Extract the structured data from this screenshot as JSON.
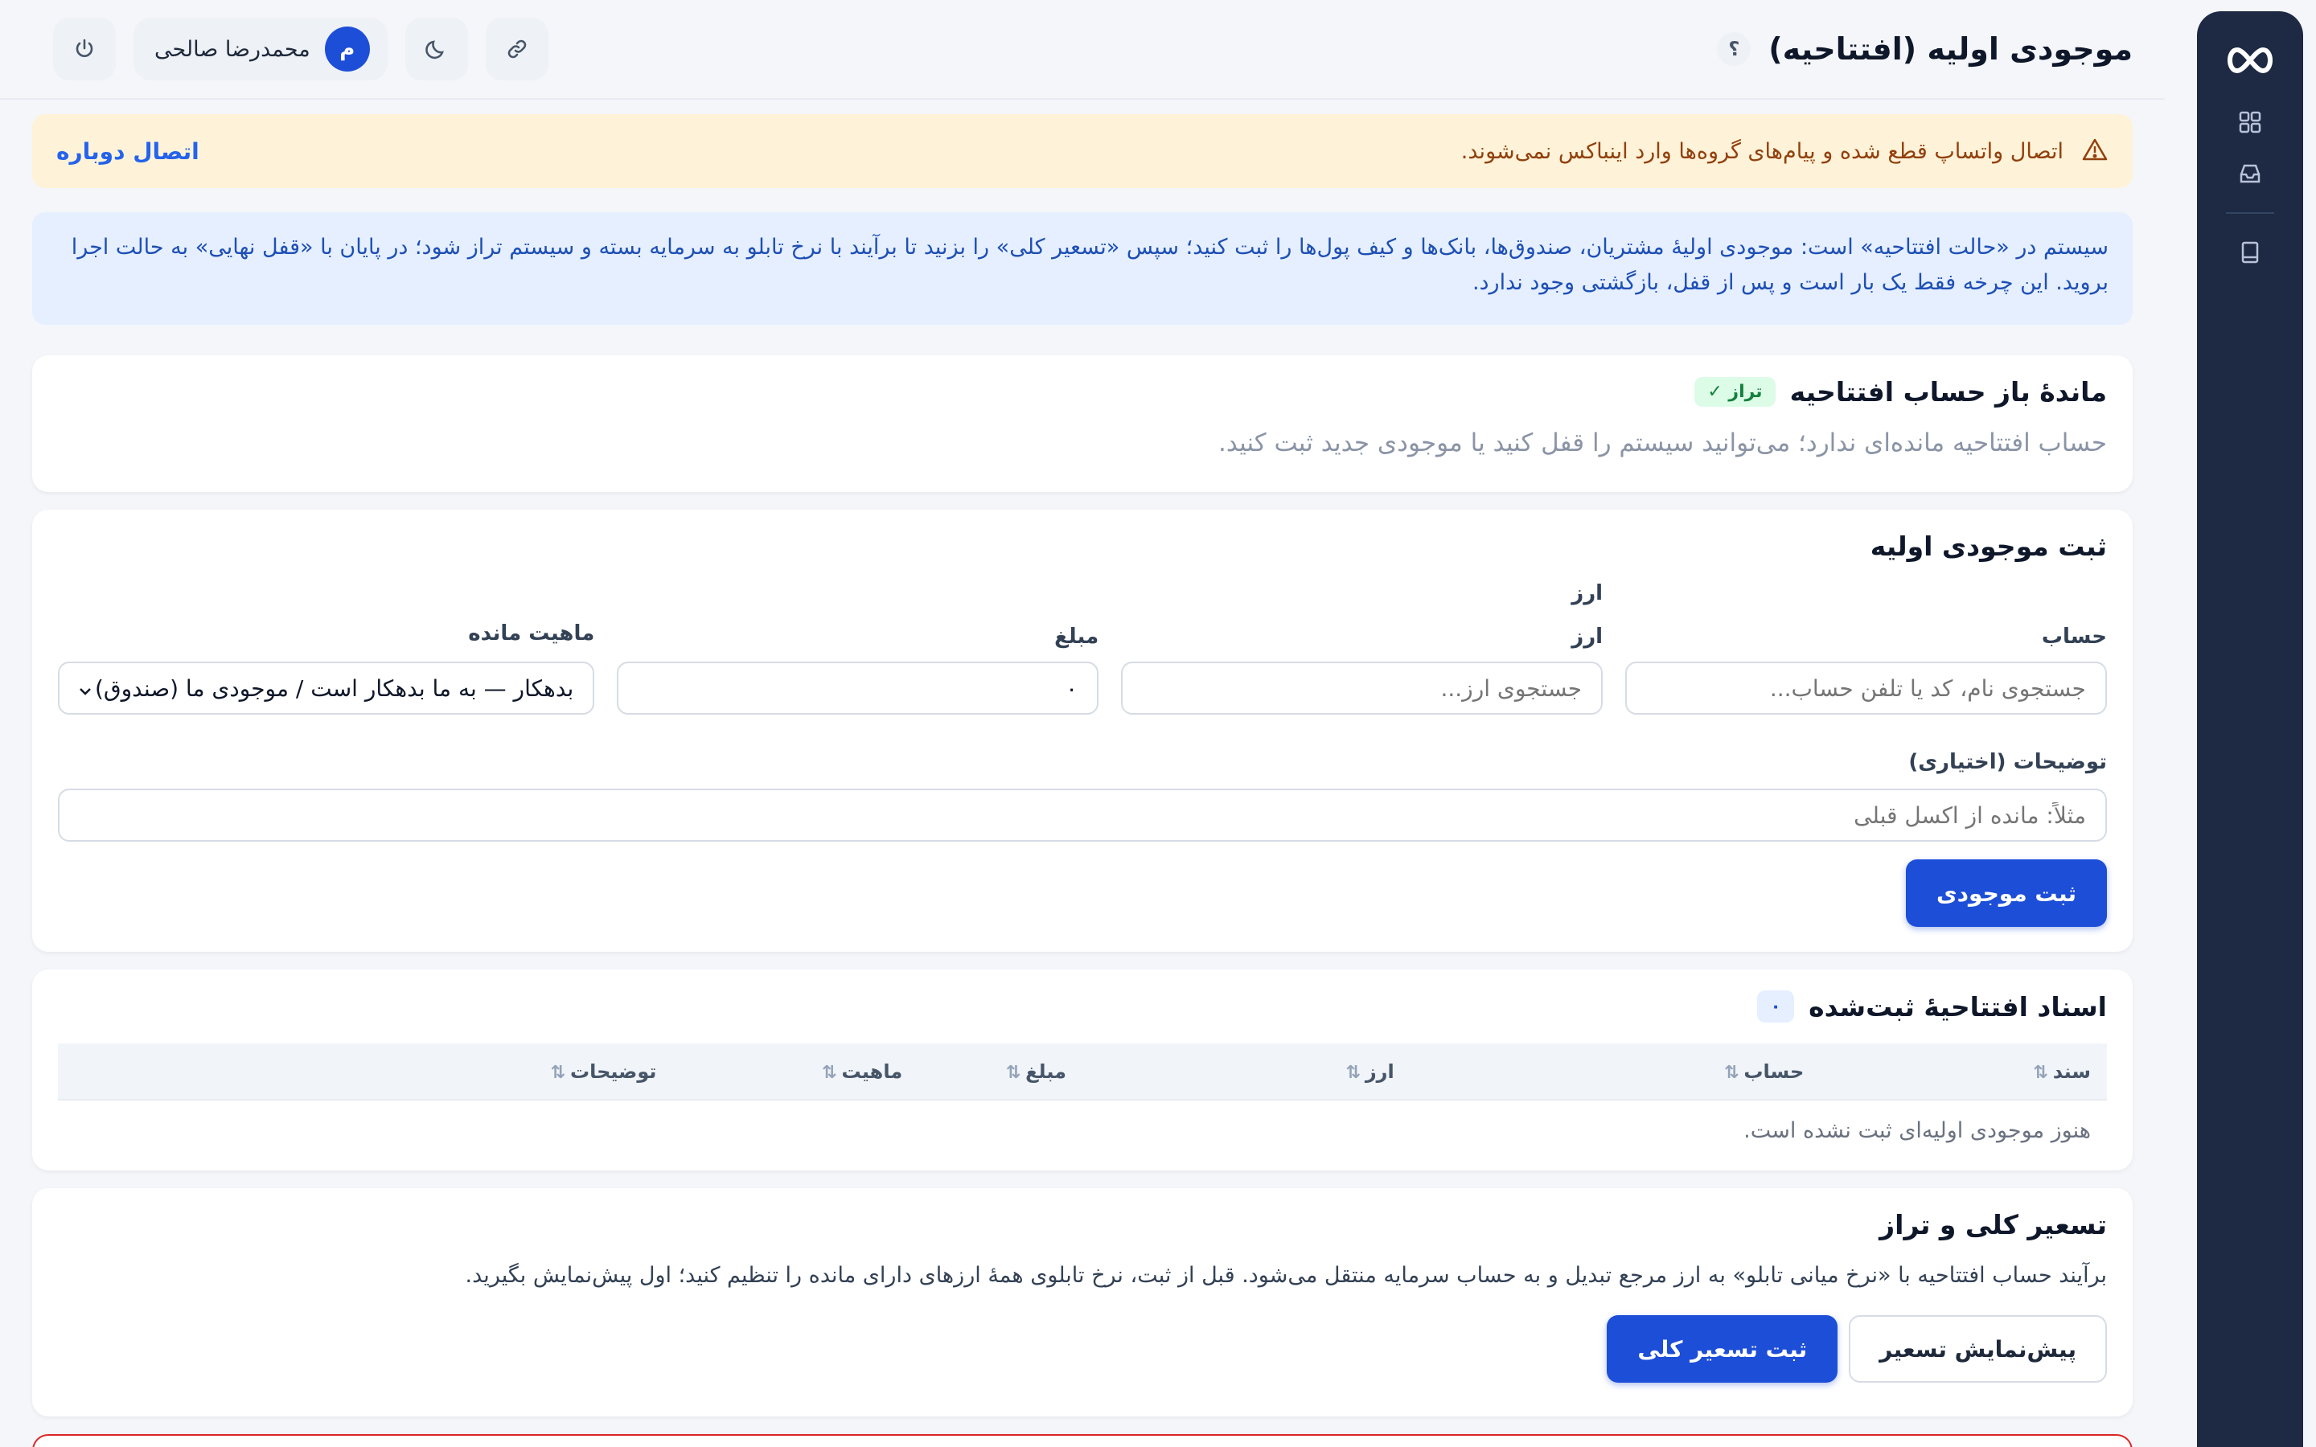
{
  "header": {
    "title": "موجودی اولیه (افتتاحیه)",
    "help_label": "؟",
    "user_initial": "م",
    "user_name": "محمدرضا صالحی"
  },
  "warning": {
    "text": "اتصال واتساپ قطع شده و پیام‌های گروه‌ها وارد اینباکس نمی‌شوند.",
    "action": "اتصال دوباره"
  },
  "info": {
    "text": "سیستم در «حالت افتتاحیه» است: موجودی اولیهٔ مشتریان، صندوق‌ها، بانک‌ها و کیف پول‌ها را ثبت کنید؛ سپس «تسعیر کلی» را بزنید تا برآیند با نرخ تابلو به سرمایه بسته و سیستم تراز شود؛ در پایان با «قفل نهایی» به حالت اجرا بروید. این چرخه فقط یک بار است و پس از قفل، بازگشتی وجود ندارد."
  },
  "balance_card": {
    "title": "ماندهٔ باز حساب افتتاحیه",
    "badge": "تراز ✓",
    "message": "حساب افتتاحیه مانده‌ای ندارد؛ می‌توانید سیستم را قفل کنید یا موجودی جدید ثبت کنید."
  },
  "form": {
    "title": "ثبت موجودی اولیه",
    "account_label": "حساب",
    "account_placeholder": "جستجوی نام، کد یا تلفن حساب...",
    "currency_top_label": "ارز",
    "currency_label": "ارز",
    "currency_placeholder": "جستجوی ارز...",
    "amount_label": "مبلغ",
    "amount_value": "۰",
    "nature_label": "ماهیت مانده",
    "nature_value": "بدهکار — به ما بدهکار است / موجودی ما (صندوق)",
    "desc_label": "توضیحات (اختیاری)",
    "desc_placeholder": "مثلاً: مانده از اکسل قبلی",
    "submit": "ثبت موجودی"
  },
  "docs": {
    "title": "اسناد افتتاحیهٔ ثبت‌شده",
    "count": "۰",
    "columns": [
      "سند",
      "حساب",
      "ارز",
      "مبلغ",
      "ماهیت",
      "توضیحات"
    ],
    "empty": "هنوز موجودی اولیه‌ای ثبت نشده است."
  },
  "revaluation": {
    "title": "تسعیر کلی و تراز",
    "text": "برآیند حساب افتتاحیه با «نرخ میانی تابلو» به ارز مرجع تبدیل و به حساب سرمایه منتقل می‌شود. قبل از ثبت، نرخ تابلوی همهٔ ارزهای دارای مانده را تنظیم کنید؛ اول پیش‌نمایش بگیرید.",
    "preview_button": "پیش‌نمایش تسعیر",
    "submit_button": "ثبت تسعیر کلی"
  },
  "colors": {
    "primary": "#1d4ed8",
    "rail": "#1e2a44",
    "warning_bg": "#fef3d8",
    "info_bg": "#e5efff",
    "success": "#15803d",
    "danger": "#dc2626"
  },
  "icons": [
    "infinity-logo-icon",
    "dashboard-icon",
    "inbox-icon",
    "book-icon",
    "help-icon",
    "link-icon",
    "moon-icon",
    "power-icon",
    "warning-icon",
    "chevron-down-icon",
    "sort-icon"
  ]
}
